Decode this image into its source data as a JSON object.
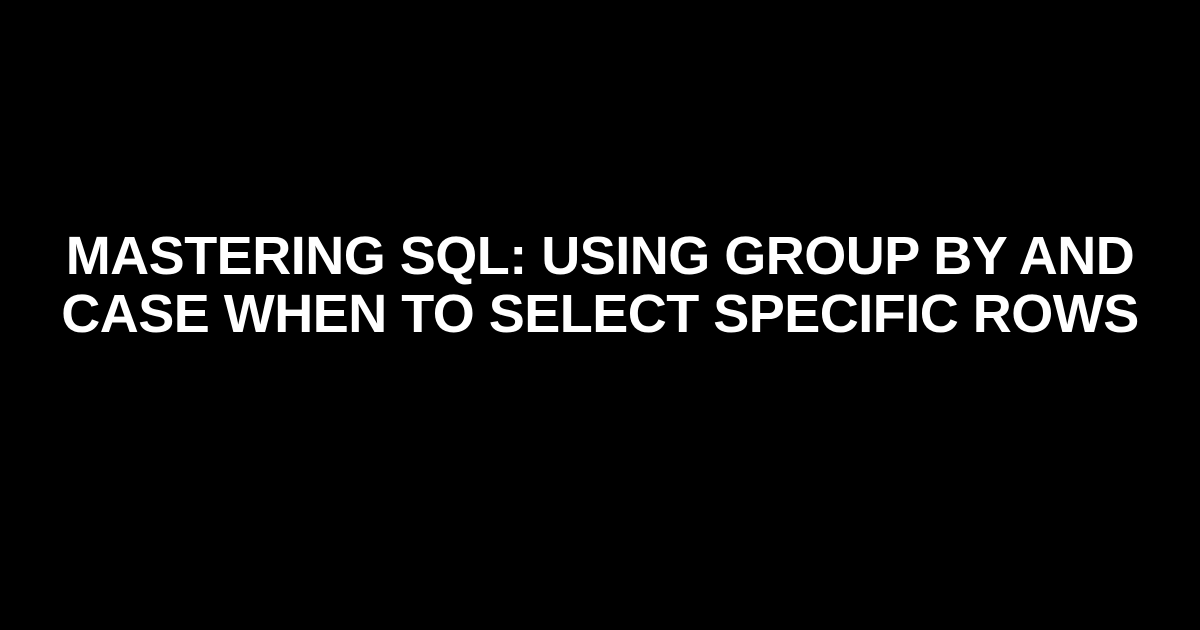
{
  "title": "Mastering SQL: Using GROUP BY and CASE WHEN to Select Specific Rows"
}
